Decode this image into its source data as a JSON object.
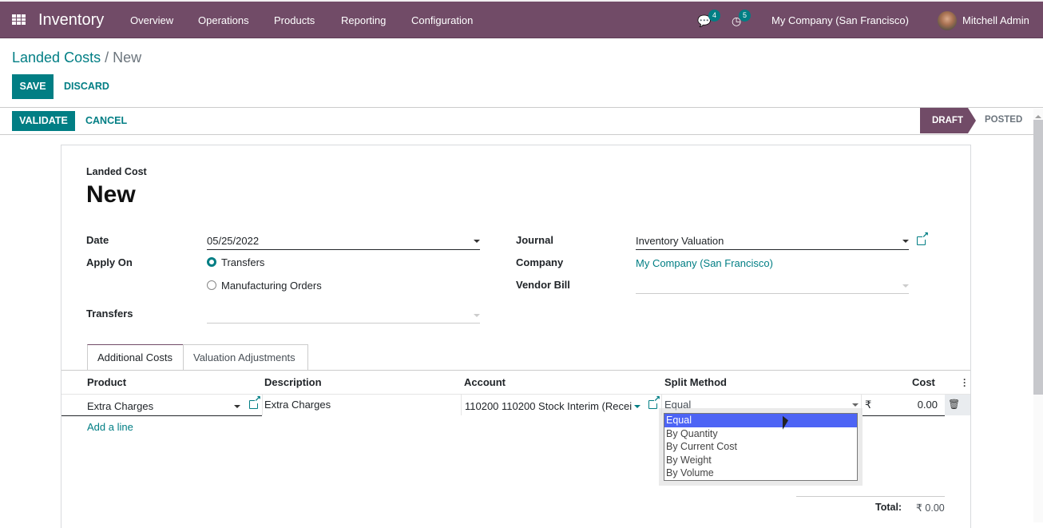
{
  "navbar": {
    "app_name": "Inventory",
    "menu": [
      "Overview",
      "Operations",
      "Products",
      "Reporting",
      "Configuration"
    ],
    "messages_count": "4",
    "activities_count": "5",
    "company": "My Company (San Francisco)",
    "user": "Mitchell Admin",
    "bg_color": "#714b67"
  },
  "breadcrumb": {
    "parent": "Landed Costs",
    "separator": "/",
    "current": "New"
  },
  "control": {
    "save": "SAVE",
    "discard": "DISCARD"
  },
  "statusbar": {
    "validate": "VALIDATE",
    "cancel": "CANCEL",
    "stages": [
      "DRAFT",
      "POSTED"
    ],
    "current_stage": "DRAFT"
  },
  "form": {
    "title_label": "Landed Cost",
    "title": "New",
    "date_label": "Date",
    "date_value": "05/25/2022",
    "apply_on_label": "Apply On",
    "apply_on_options": [
      "Transfers",
      "Manufacturing Orders"
    ],
    "apply_on_selected": "Transfers",
    "transfers_label": "Transfers",
    "transfers_value": "",
    "journal_label": "Journal",
    "journal_value": "Inventory Valuation",
    "company_label": "Company",
    "company_value": "My Company (San Francisco)",
    "vendor_bill_label": "Vendor Bill",
    "vendor_bill_value": ""
  },
  "tabs": [
    {
      "label": "Additional Costs",
      "active": true
    },
    {
      "label": "Valuation Adjustments",
      "active": false
    }
  ],
  "cost_table": {
    "headers": [
      "Product",
      "Description",
      "Account",
      "Split Method",
      "Cost"
    ],
    "rows": [
      {
        "product": "Extra Charges",
        "description": "Extra Charges",
        "account": "110200 110200 Stock Interim (Recei",
        "split_method": "Equal",
        "currency": "₹",
        "cost": "0.00"
      }
    ],
    "add_line": "Add a line",
    "total_label": "Total:",
    "total_value": "₹ 0.00"
  },
  "split_dropdown": {
    "options": [
      "Equal",
      "By Quantity",
      "By Current Cost",
      "By Weight",
      "By Volume"
    ],
    "highlighted": "Equal"
  }
}
